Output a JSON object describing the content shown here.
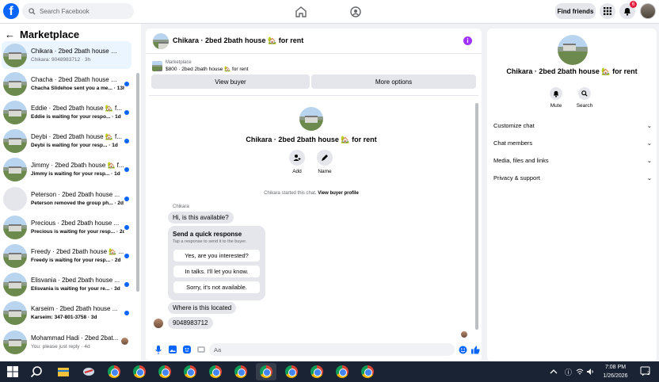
{
  "topbar": {
    "logo": "f",
    "search_placeholder": "Search Facebook",
    "find_friends": "Find friends",
    "notification_count": "6"
  },
  "sidebar": {
    "title": "Marketplace",
    "conversations": [
      {
        "name": "Chikara · 2bed 2bath house 🏡 f...",
        "sub": "Chikara: 9048983712 · 3h",
        "unread": false
      },
      {
        "name": "Chacha · 2bed 2bath house 🏡 ...",
        "sub": "Chacha Slidehoe sent you a me... · 13h",
        "unread": true
      },
      {
        "name": "Eddie · 2bed 2bath house 🏡 f...",
        "sub": "Eddie is waiting for your respo... · 1d",
        "unread": true
      },
      {
        "name": "Deybi · 2bed 2bath house 🏡 f...",
        "sub": "Deybi is waiting for your resp... · 1d",
        "unread": true
      },
      {
        "name": "Jimmy · 2bed 2bath house 🏡 f...",
        "sub": "Jimmy is waiting for your resp... · 1d",
        "unread": true
      },
      {
        "name": "Peterson · 2bed 2bath house ...",
        "sub": "Peterson removed the group ph... · 2d",
        "unread": true
      },
      {
        "name": "Precious · 2bed 2bath house ...",
        "sub": "Precious is waiting for your resp... · 2d",
        "unread": true
      },
      {
        "name": "Freedy · 2bed 2bath house 🏡 ...",
        "sub": "Freedy is waiting for your resp... · 2d",
        "unread": true
      },
      {
        "name": "Elisvania · 2bed 2bath house ...",
        "sub": "Elisvania is waiting for your re... · 3d",
        "unread": true
      },
      {
        "name": "Karseim · 2bed 2bath house ...",
        "sub": "Karseim: 347-801-3758 · 3d",
        "unread": true
      },
      {
        "name": "Mohammad Hadi · 2bed 2bat...",
        "sub": "You: please just reply · 4d",
        "unread": false
      }
    ]
  },
  "chat": {
    "header_title": "Chikara · 2bed 2bath house 🏡 for rent",
    "listing_label": "Marketplace",
    "listing_value": "$800 · 2bed 2bath house 🏡 for rent",
    "view_buyer": "View buyer",
    "more_options": "More options",
    "center_title": "Chikara · 2bed 2bath house 🏡 for rent",
    "add_label": "Add",
    "name_label": "Name",
    "system_msg": "Chikara started this chat.",
    "system_link": "View buyer profile",
    "sender": "Chikara",
    "msg1": "Hi, is this available?",
    "quick_title": "Send a quick response",
    "quick_sub": "Tap a response to send it to the buyer.",
    "quick_options": [
      "Yes, are you interested?",
      "In talks. I'll let you know.",
      "Sorry, it's not available."
    ],
    "msg2": "Where is this located",
    "msg3": "9048983712",
    "composer_placeholder": "Aa"
  },
  "details": {
    "title": "Chikara · 2bed 2bath house 🏡 for rent",
    "mute": "Mute",
    "search": "Search",
    "rows": [
      "Customize chat",
      "Chat members",
      "Media, files and links",
      "Privacy & support"
    ]
  },
  "taskbar": {
    "time": "7:08 PM",
    "date": "1/26/2026",
    "notif": "2"
  },
  "colors": {
    "brand": "#0866ff",
    "unread_dot": "#0866ff",
    "badge": "#e41e3f",
    "info": "#a033ff",
    "taskbar": "#1a2333"
  }
}
